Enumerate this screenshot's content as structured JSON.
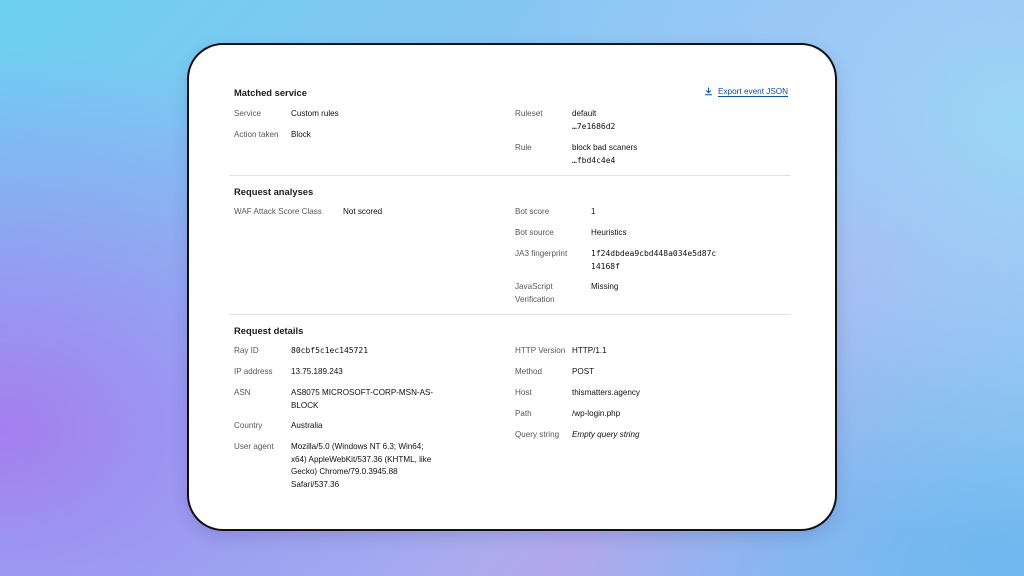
{
  "export": {
    "label": "Export event JSON",
    "icon": "download-icon"
  },
  "matched_service": {
    "title": "Matched service",
    "service_label": "Service",
    "service_value": "Custom rules",
    "action_label": "Action taken",
    "action_value": "Block",
    "ruleset_label": "Ruleset",
    "ruleset_value": "default",
    "ruleset_id": "…7e1686d2",
    "rule_label": "Rule",
    "rule_value": "block bad scaners",
    "rule_id": "…fbd4c4e4"
  },
  "request_analyses": {
    "title": "Request analyses",
    "waf_label": "WAF Attack Score Class",
    "waf_value": "Not scored",
    "bot_score_label": "Bot score",
    "bot_score_value": "1",
    "bot_source_label": "Bot source",
    "bot_source_value": "Heuristics",
    "ja3_label": "JA3 fingerprint",
    "ja3_value": "1f24dbdea9cbd448a034e5d87c14168f",
    "js_label": "JavaScript Verification",
    "js_value": "Missing"
  },
  "request_details": {
    "title": "Request details",
    "ray_label": "Ray ID",
    "ray_value": "80cbf5c1ec145721",
    "ip_label": "IP address",
    "ip_value": "13.75.189.243",
    "asn_label": "ASN",
    "asn_value": "AS8075 MICROSOFT-CORP-MSN-AS-BLOCK",
    "country_label": "Country",
    "country_value": "Australia",
    "ua_label": "User agent",
    "ua_value": "Mozilla/5.0 (Windows NT 6.3; Win64; x64) AppleWebKit/537.36 (KHTML, like Gecko) Chrome/79.0.3945.88 Safari/537.36",
    "http_label": "HTTP Version",
    "http_value": "HTTP/1.1",
    "method_label": "Method",
    "method_value": "POST",
    "host_label": "Host",
    "host_value": "thismatters.agency",
    "path_label": "Path",
    "path_value": "/wp-login.php",
    "query_label": "Query string",
    "query_value": "Empty query string"
  }
}
